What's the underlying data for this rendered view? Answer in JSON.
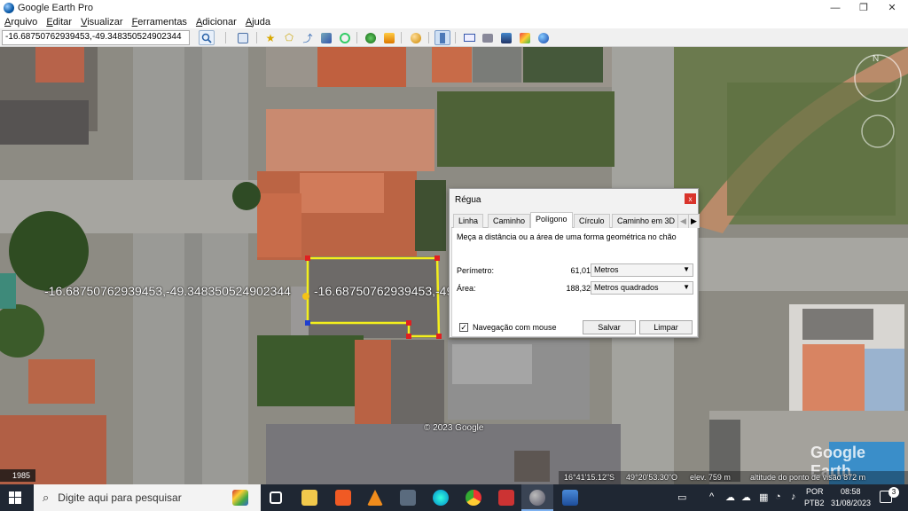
{
  "window": {
    "title": "Google Earth Pro"
  },
  "menu": [
    "Arquivo",
    "Editar",
    "Visualizar",
    "Ferramentas",
    "Adicionar",
    "Ajuda"
  ],
  "search": {
    "value": "-16.68750762939453,-49.348350524902344"
  },
  "toolbar_icons": [
    "search-icon",
    "sidebar-toggle-icon",
    "placemark-icon",
    "polygon-icon",
    "path-icon",
    "overlay-icon",
    "tour-icon",
    "historical-imagery-icon",
    "sunlight-icon",
    "planets-icon",
    "ruler-icon",
    "email-icon",
    "print-icon",
    "save-image-icon",
    "maps-icon",
    "earth-icon"
  ],
  "map": {
    "label_left": "-16.68750762939453,-49.348350524902344",
    "label_right": "-16.68750762939453,-49",
    "copyright": "© 2023 Google",
    "watermark": "Google Earth",
    "year": "1985",
    "status": {
      "lat": "16°41'15.12\"S",
      "lon": "49°20'53.30\"O",
      "elev": "elev. 759 m",
      "eye_alt": "altitude do ponto de visão 872 m"
    }
  },
  "ruler": {
    "title": "Régua",
    "close": "x",
    "tabs": [
      "Linha",
      "Caminho",
      "Polígono",
      "Círculo",
      "Caminho em 3D"
    ],
    "active_tab": "Polígono",
    "description": "Meça a distância ou a área de uma forma geométrica no chão",
    "perimeter_label": "Perímetro:",
    "perimeter_value": "61,01",
    "perimeter_unit": "Metros",
    "area_label": "Área:",
    "area_value": "188,32",
    "area_unit": "Metros quadrados",
    "mouse_nav_label": "Navegação com mouse",
    "mouse_nav_checked": true,
    "save_label": "Salvar",
    "clear_label": "Limpar"
  },
  "taskbar": {
    "search_placeholder": "Digite aqui para pesquisar",
    "lang": "POR",
    "layout": "PTB2",
    "time": "08:58",
    "date": "31/08/2023",
    "notifications": "3"
  }
}
